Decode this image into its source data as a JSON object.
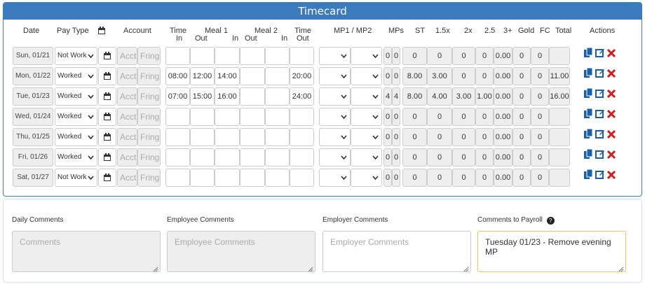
{
  "title": "Timecard",
  "headers": {
    "date": "Date",
    "pay_type": "Pay Type",
    "account": "Account",
    "time_in_1": "Time",
    "time_in_2": "In",
    "meal1": "Meal 1",
    "meal1_out": "Out",
    "meal1_in": "In",
    "meal2": "Meal 2",
    "meal2_out": "Out",
    "meal2_in": "In",
    "time_out_1": "Time",
    "time_out_2": "Out",
    "mp": "MP1 / MP2",
    "mps": "MPs",
    "st": "ST",
    "x15": "1.5x",
    "x2": "2x",
    "x25": "2.5",
    "x3": "3+",
    "gold": "Gold",
    "fc": "FC",
    "total": "Total",
    "actions": "Actions"
  },
  "rows": [
    {
      "date": "Sun, 01/21",
      "pay_type": "Not Work",
      "acct": "Acct",
      "fringe": "Fringe",
      "time_in": "",
      "meal1_out": "",
      "meal1_in": "",
      "meal2_out": "",
      "meal2_in": "",
      "time_out": "",
      "mp1": "",
      "mp2": "",
      "mps1": "0",
      "mps2": "0",
      "st": "0",
      "x15": "0",
      "x2": "0",
      "x25": "0",
      "x3": "0.00",
      "gold": "0",
      "fc": "0",
      "total": ""
    },
    {
      "date": "Mon, 01/22",
      "pay_type": "Worked",
      "acct": "Acct",
      "fringe": "Fringe",
      "time_in": "08:00",
      "meal1_out": "12:00",
      "meal1_in": "14:00",
      "meal2_out": "",
      "meal2_in": "",
      "time_out": "20:00",
      "mp1": "",
      "mp2": "",
      "mps1": "0",
      "mps2": "0",
      "st": "8.00",
      "x15": "3.00",
      "x2": "0",
      "x25": "0",
      "x3": "0.00",
      "gold": "0",
      "fc": "0",
      "total": "11.00"
    },
    {
      "date": "Tue, 01/23",
      "pay_type": "Worked",
      "acct": "Acct",
      "fringe": "Fringe",
      "time_in": "07:00",
      "meal1_out": "15:00",
      "meal1_in": "16:00",
      "meal2_out": "",
      "meal2_in": "",
      "time_out": "24:00",
      "mp1": "",
      "mp2": "",
      "mps1": "4",
      "mps2": "4",
      "st": "8.00",
      "x15": "4.00",
      "x2": "3.00",
      "x25": "1.00",
      "x3": "0.00",
      "gold": "0",
      "fc": "0",
      "total": "16.00"
    },
    {
      "date": "Wed, 01/24",
      "pay_type": "Worked",
      "acct": "Acct",
      "fringe": "Fringe",
      "time_in": "",
      "meal1_out": "",
      "meal1_in": "",
      "meal2_out": "",
      "meal2_in": "",
      "time_out": "",
      "mp1": "",
      "mp2": "",
      "mps1": "0",
      "mps2": "0",
      "st": "0",
      "x15": "0",
      "x2": "0",
      "x25": "0",
      "x3": "0.00",
      "gold": "0",
      "fc": "0",
      "total": ""
    },
    {
      "date": "Thu, 01/25",
      "pay_type": "Worked",
      "acct": "Acct",
      "fringe": "Fringe",
      "time_in": "",
      "meal1_out": "",
      "meal1_in": "",
      "meal2_out": "",
      "meal2_in": "",
      "time_out": "",
      "mp1": "",
      "mp2": "",
      "mps1": "0",
      "mps2": "0",
      "st": "0",
      "x15": "0",
      "x2": "0",
      "x25": "0",
      "x3": "0.00",
      "gold": "0",
      "fc": "0",
      "total": ""
    },
    {
      "date": "Fri, 01/26",
      "pay_type": "Worked",
      "acct": "Acct",
      "fringe": "Fringe",
      "time_in": "",
      "meal1_out": "",
      "meal1_in": "",
      "meal2_out": "",
      "meal2_in": "",
      "time_out": "",
      "mp1": "",
      "mp2": "",
      "mps1": "0",
      "mps2": "0",
      "st": "0",
      "x15": "0",
      "x2": "0",
      "x25": "0",
      "x3": "0.00",
      "gold": "0",
      "fc": "0",
      "total": ""
    },
    {
      "date": "Sat, 01/27",
      "pay_type": "Not Work",
      "acct": "Acct",
      "fringe": "Fringe",
      "time_in": "",
      "meal1_out": "",
      "meal1_in": "",
      "meal2_out": "",
      "meal2_in": "",
      "time_out": "",
      "mp1": "",
      "mp2": "",
      "mps1": "0",
      "mps2": "0",
      "st": "0",
      "x15": "0",
      "x2": "0",
      "x25": "0",
      "x3": "0.00",
      "gold": "0",
      "fc": "0",
      "total": ""
    }
  ],
  "icons": {
    "calendar": "calendar-icon",
    "copy": "copy-icon",
    "edit": "edit-icon",
    "delete": "delete-icon",
    "help": "help-icon",
    "chevron": "chevron-down-icon"
  },
  "colors": {
    "header_bg": "#3a7abd",
    "action_blue": "#1a5fa8",
    "delete_red": "#cc1f1f",
    "active_border": "#e8c95a"
  },
  "comments": {
    "daily_label": "Daily Comments",
    "daily_placeholder": "Comments",
    "employee_label": "Employee Comments",
    "employee_placeholder": "Employee Comments",
    "employer_label": "Employer Comments",
    "employer_placeholder": "Employer Comments",
    "payroll_label": "Comments to Payroll",
    "payroll_value": "Tuesday 01/23 - Remove evening MP"
  }
}
